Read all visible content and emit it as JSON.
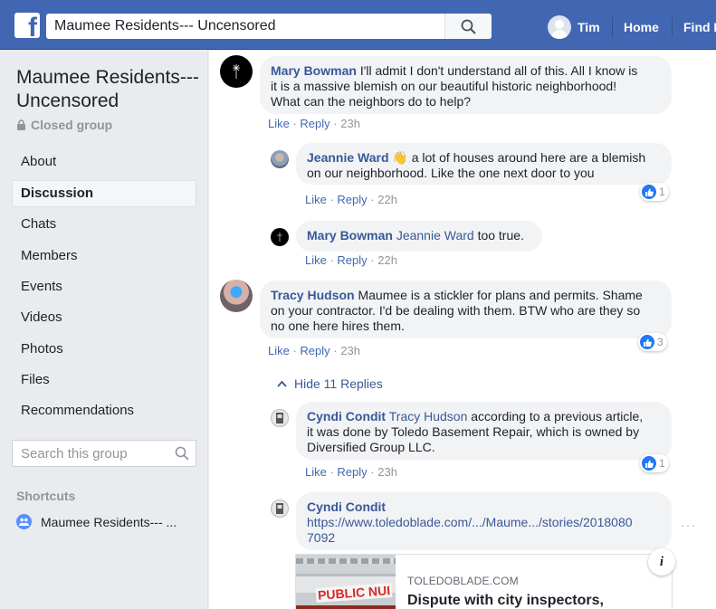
{
  "topbar": {
    "logo_letter": "f",
    "search_value": "Maumee Residents--- Uncensored",
    "user_name": "Tim",
    "links": [
      "Home",
      "Find F"
    ]
  },
  "sidebar": {
    "group_name": "Maumee Residents--- Uncensored",
    "group_type": "Closed group",
    "nav": [
      {
        "label": "About",
        "active": false
      },
      {
        "label": "Discussion",
        "active": true
      },
      {
        "label": "Chats",
        "active": false
      },
      {
        "label": "Members",
        "active": false
      },
      {
        "label": "Events",
        "active": false
      },
      {
        "label": "Videos",
        "active": false
      },
      {
        "label": "Photos",
        "active": false
      },
      {
        "label": "Files",
        "active": false
      },
      {
        "label": "Recommendations",
        "active": false
      }
    ],
    "search_placeholder": "Search this group",
    "shortcuts_heading": "Shortcuts",
    "shortcut_label": "Maumee Residents--- ..."
  },
  "comments": [
    {
      "author": "Mary Bowman",
      "lines": [
        "I'll admit I don't understand all of this. All I know is",
        "it is a massive blemish on our beautiful historic neighborhood!",
        "What can the neighbors do to help?"
      ],
      "first_line_text": "I'll admit I don't understand all of this. All I know is",
      "like": "Like",
      "reply": "Reply",
      "time": "23h"
    },
    {
      "author": "Jeannie Ward",
      "emoji": "👋",
      "line1": "a lot of houses around here are a blemish",
      "line2": "on our neighborhood. Like the one next door to you",
      "like": "Like",
      "reply": "Reply",
      "time": "22h",
      "reactions": "1"
    },
    {
      "author": "Mary Bowman",
      "mention": "Jeannie Ward",
      "text": "too true.",
      "like": "Like",
      "reply": "Reply",
      "time": "22h"
    },
    {
      "author": "Tracy Hudson",
      "line1": "Maumee is a stickler for plans and permits. Shame",
      "line2": "on your contractor. I'd be dealing with them. BTW who are they so",
      "line3": "no one here hires them.",
      "like": "Like",
      "reply": "Reply",
      "time": "23h",
      "reactions": "3"
    },
    {
      "author": "Cyndi Condit",
      "mention": "Tracy Hudson",
      "line1": "according to a previous article,",
      "line2": "it was done by Toledo Basement Repair, which is owned by",
      "line3": "Diversified Group LLC.",
      "like": "Like",
      "reply": "Reply",
      "time": "23h",
      "reactions": "1"
    },
    {
      "author": "Cyndi Condit",
      "link_line1": "https://www.toledoblade.com/.../Maume.../stories/2018080",
      "link_line2": "7092",
      "dots": "···",
      "preview_sign": "PUBLIC NUI",
      "preview_domain": "TOLEDOBLADE.COM",
      "preview_title": "Dispute with city inspectors,"
    }
  ],
  "hide_replies_label": "Hide 11 Replies",
  "colors": {
    "brand": "#4267b2",
    "link": "#385898",
    "like_blue": "#2078f4"
  }
}
